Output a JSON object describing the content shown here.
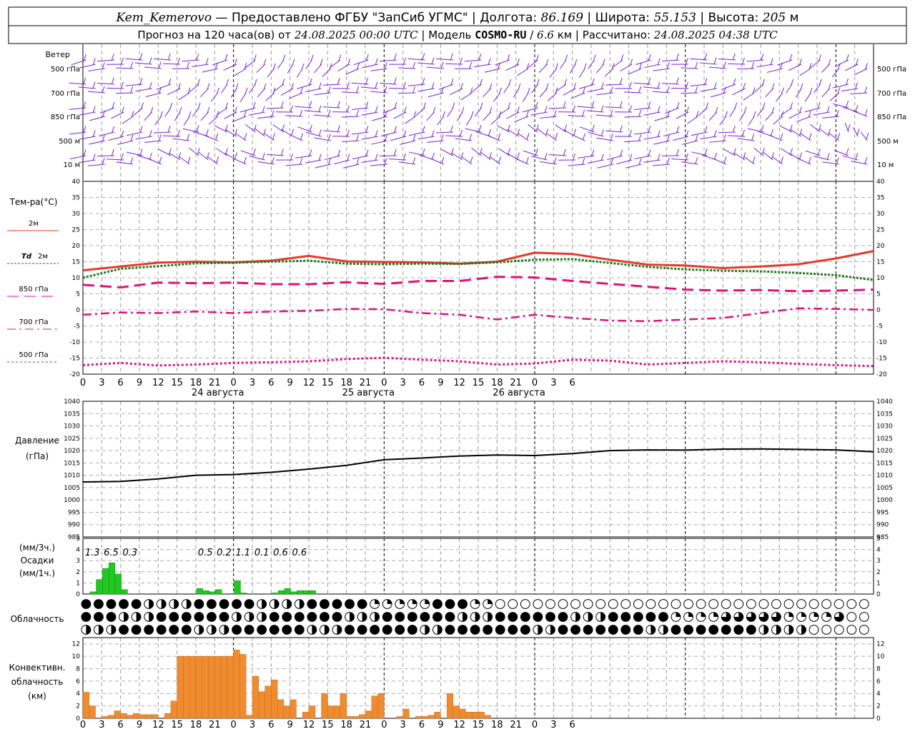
{
  "header": {
    "station": "Kem_Kemerovo",
    "provider": "Предоставлено ФГБУ \"ЗапСиб УГМС\"",
    "lon_label": "Долгота:",
    "lon_value": "86.169",
    "lat_label": "Широта:",
    "lat_value": "55.153",
    "alt_label": "Высота:",
    "alt_value": "205",
    "alt_unit": "м",
    "forecast_prefix": "Прогноз на 120 часа(ов) от",
    "forecast_time": "24.08.2025 00:00 UTC",
    "model_label": "Модель",
    "model_name": "COSMO-RU",
    "model_res": "6.6",
    "model_res_unit": "км",
    "calc_label": "Рассчитано:",
    "calc_time": "24.08.2025 04:38 UTC"
  },
  "wind_panel": {
    "title": "Ветер",
    "levels": [
      "500 гПа",
      "700 гПа",
      "850 гПа",
      "500 м",
      "10 м"
    ],
    "color": "#7a1fd6"
  },
  "x_axis": {
    "tick_labels": [
      "0",
      "3",
      "6",
      "9",
      "12",
      "15",
      "18",
      "21",
      "0",
      "3",
      "6",
      "9",
      "12",
      "15",
      "18",
      "21",
      "0",
      "3",
      "6",
      "9",
      "12",
      "15",
      "18",
      "21",
      "0",
      "3",
      "6"
    ],
    "day_labels": [
      "24 августа",
      "25 августа",
      "26 августа"
    ]
  },
  "temp_panel": {
    "title": "Тем-ра(°C)",
    "legend": [
      {
        "label": "2м",
        "color": "#e8382e"
      },
      {
        "label": "Td",
        "label2": "2м",
        "color": "#1a7a1a"
      },
      {
        "label": "850 гПа",
        "color": "#e0127a"
      },
      {
        "label": "700 гПа",
        "color": "#e0127a"
      },
      {
        "label": "500 гПа",
        "color": "#e0127a"
      }
    ]
  },
  "pressure_panel": {
    "title1": "Давление",
    "title2": "(гПа)"
  },
  "precip_panel": {
    "title1": "(мм/3ч.)",
    "title2": "Осадки",
    "title3": "(мм/1ч.)",
    "color": "#22c822",
    "labels": [
      {
        "h": 3,
        "text": "1.3"
      },
      {
        "h": 6,
        "text": "6.5"
      },
      {
        "h": 9,
        "text": "0.3"
      },
      {
        "h": 21,
        "text": "0.5"
      },
      {
        "h": 24,
        "text": "0.2"
      },
      {
        "h": 27,
        "text": "1.1"
      },
      {
        "h": 30,
        "text": "0.1"
      },
      {
        "h": 33,
        "text": "0.6"
      },
      {
        "h": 36,
        "text": "0.6"
      }
    ]
  },
  "cloud_panel": {
    "title": "Облачность"
  },
  "conv_panel": {
    "title1": "Конвективн.",
    "title2": "облачность",
    "title3": "(км)",
    "color": "#f08c30"
  },
  "chart_data": [
    {
      "type": "line",
      "name": "temperature",
      "x_unit": "hours since 24.08.2025 00:00 UTC",
      "ylim": [
        -20,
        40
      ],
      "y_ticks": [
        -20,
        -15,
        -10,
        -5,
        0,
        5,
        10,
        15,
        20,
        25,
        30,
        35,
        40
      ],
      "grid": true,
      "series": [
        {
          "name": "2м",
          "color": "#e8382e",
          "x": [
            0,
            6,
            12,
            18,
            24,
            30,
            36,
            42,
            48,
            54,
            60,
            66,
            72,
            78,
            84,
            90,
            96,
            102,
            108,
            114,
            120,
            126
          ],
          "values": [
            12.3,
            13.5,
            14.7,
            15.0,
            14.8,
            15.3,
            16.8,
            15.1,
            14.9,
            14.8,
            14.4,
            15.0,
            17.8,
            17.4,
            15.6,
            14.1,
            13.8,
            13.0,
            13.5,
            14.2,
            16.0,
            18.3
          ]
        },
        {
          "name": "Td 2м",
          "color": "#1a7a1a",
          "x": [
            0,
            6,
            12,
            18,
            24,
            30,
            36,
            42,
            48,
            54,
            60,
            66,
            72,
            78,
            84,
            90,
            96,
            102,
            108,
            114,
            120,
            126
          ],
          "values": [
            10.0,
            12.8,
            13.6,
            14.5,
            14.7,
            15.0,
            15.3,
            14.4,
            14.2,
            14.4,
            14.3,
            14.8,
            15.6,
            15.8,
            14.6,
            13.4,
            12.6,
            12.2,
            12.0,
            11.5,
            10.8,
            9.3
          ]
        },
        {
          "name": "850 гПа",
          "color": "#e0127a",
          "x": [
            0,
            6,
            12,
            18,
            24,
            30,
            36,
            42,
            48,
            54,
            60,
            66,
            72,
            78,
            84,
            90,
            96,
            102,
            108,
            114,
            120,
            126
          ],
          "values": [
            7.8,
            7.0,
            8.5,
            8.3,
            8.5,
            8.0,
            8.0,
            8.6,
            8.1,
            9.0,
            9.0,
            10.3,
            10.1,
            9.0,
            8.1,
            7.2,
            6.3,
            6.0,
            6.2,
            5.8,
            6.0,
            6.3
          ]
        },
        {
          "name": "700 гПа",
          "color": "#e0127a",
          "x": [
            0,
            6,
            12,
            18,
            24,
            30,
            36,
            42,
            48,
            54,
            60,
            66,
            72,
            78,
            84,
            90,
            96,
            102,
            108,
            114,
            120,
            126
          ],
          "values": [
            -1.5,
            -0.8,
            -1.0,
            -0.5,
            -1.0,
            -0.5,
            -0.3,
            0.3,
            0.2,
            -1.0,
            -1.5,
            -3.0,
            -1.5,
            -2.5,
            -3.3,
            -3.5,
            -3.0,
            -2.5,
            -1.0,
            0.5,
            0.3,
            0.0
          ]
        },
        {
          "name": "500 гПа",
          "color": "#e0127a",
          "x": [
            0,
            6,
            12,
            18,
            24,
            30,
            36,
            42,
            48,
            54,
            60,
            66,
            72,
            78,
            84,
            90,
            96,
            102,
            108,
            114,
            120,
            126
          ],
          "values": [
            -17.2,
            -16.5,
            -17.3,
            -17.0,
            -16.5,
            -16.3,
            -16.0,
            -15.3,
            -14.9,
            -15.5,
            -16.0,
            -17.0,
            -16.7,
            -15.5,
            -15.8,
            -17.0,
            -16.5,
            -16.0,
            -16.3,
            -16.8,
            -17.2,
            -17.5
          ]
        }
      ]
    },
    {
      "type": "line",
      "name": "pressure",
      "x_unit": "hours since 24.08.2025 00:00 UTC",
      "ylim": [
        985,
        1040
      ],
      "y_ticks": [
        985,
        990,
        995,
        1000,
        1005,
        1010,
        1015,
        1020,
        1025,
        1030,
        1035,
        1040
      ],
      "grid": true,
      "series": [
        {
          "name": "pressure",
          "color": "#000000",
          "x": [
            0,
            6,
            12,
            18,
            24,
            30,
            36,
            42,
            48,
            54,
            60,
            66,
            72,
            78,
            84,
            90,
            96,
            102,
            108,
            114,
            120,
            126
          ],
          "values": [
            1007.3,
            1007.5,
            1008.5,
            1010.0,
            1010.3,
            1011.2,
            1012.5,
            1014.0,
            1016.3,
            1017.0,
            1017.8,
            1018.2,
            1018.0,
            1018.8,
            1020.0,
            1020.3,
            1020.2,
            1020.6,
            1020.7,
            1020.5,
            1020.3,
            1019.5
          ]
        }
      ]
    },
    {
      "type": "bar",
      "name": "precipitation",
      "x_unit": "hours since 24.08.2025 00:00 UTC",
      "ylim": [
        0,
        5
      ],
      "y_ticks": [
        0,
        1,
        2,
        3,
        4,
        5
      ],
      "x": [
        0,
        1,
        2,
        3,
        4,
        5,
        6,
        7,
        8,
        9,
        10,
        11,
        12,
        13,
        14,
        15,
        16,
        17,
        18,
        19,
        20,
        21,
        22,
        23,
        24,
        25,
        26,
        27,
        28,
        29,
        30,
        31,
        32,
        33,
        34,
        35,
        36,
        37,
        38,
        39
      ],
      "values": [
        0.0,
        0.2,
        1.3,
        2.3,
        2.8,
        1.8,
        0.4,
        0.0,
        0.0,
        0.0,
        0.0,
        0.0,
        0.0,
        0.0,
        0.0,
        0.0,
        0.0,
        0.0,
        0.5,
        0.3,
        0.2,
        0.4,
        0.0,
        0.0,
        1.2,
        0.1,
        0.0,
        0.0,
        0.0,
        0.0,
        0.1,
        0.3,
        0.5,
        0.2,
        0.3,
        0.3,
        0.3,
        0.0,
        0.0,
        0.0
      ]
    },
    {
      "type": "bar",
      "name": "convective_cloud",
      "x_unit": "hours since 24.08.2025 00:00 UTC",
      "ylim": [
        0,
        13
      ],
      "y_ticks": [
        0,
        2,
        4,
        6,
        8,
        10,
        12
      ],
      "x": [
        0,
        1,
        2,
        3,
        4,
        5,
        6,
        7,
        8,
        9,
        10,
        11,
        12,
        13,
        14,
        15,
        16,
        17,
        18,
        19,
        20,
        21,
        22,
        23,
        24,
        25,
        26,
        27,
        28,
        29,
        30,
        31,
        32,
        33,
        34,
        35,
        36,
        37,
        38,
        39,
        40,
        41,
        42,
        43,
        44,
        45,
        46,
        47,
        48,
        49,
        50,
        51,
        52,
        53,
        54,
        55,
        56,
        57,
        58,
        59,
        60,
        61,
        62,
        63,
        64,
        65,
        66,
        67,
        68,
        69,
        70,
        71,
        72,
        73,
        74,
        75,
        76,
        77,
        78,
        79,
        80,
        81,
        82,
        83,
        84,
        85,
        86,
        87,
        88,
        89,
        90,
        91,
        92,
        93,
        94,
        95,
        96,
        97,
        98,
        99,
        100,
        101,
        102,
        103,
        104,
        105,
        106,
        107,
        108,
        109,
        110,
        111,
        112,
        113,
        114,
        115,
        116,
        117,
        118,
        119
      ],
      "values": [
        4.2,
        2.0,
        0.0,
        0.3,
        0.5,
        1.2,
        0.8,
        0.5,
        0.8,
        0.6,
        0.6,
        0.6,
        0.0,
        0.8,
        2.8,
        10.0,
        10.0,
        10.0,
        10.0,
        10.0,
        10.0,
        10.0,
        10.0,
        10.0,
        11.0,
        10.3,
        0.5,
        6.8,
        4.3,
        5.2,
        6.2,
        3.0,
        2.0,
        3.0,
        0.0,
        1.0,
        2.0,
        0.0,
        4.0,
        2.0,
        2.0,
        4.0,
        0.3,
        0.3,
        0.6,
        1.2,
        3.6,
        4.0,
        0.0,
        0.0,
        0.3,
        1.5,
        0.0,
        0.3,
        0.3,
        0.5,
        1.0,
        0.0,
        4.0,
        2.0,
        1.5,
        1.0,
        1.0,
        1.0,
        0.5,
        0.0,
        0.0,
        0.0,
        0.0,
        0.0,
        0.0,
        0.0,
        0.0,
        0.0,
        0.0,
        0.0,
        0.0,
        0.0,
        0.0,
        0.0,
        0.0,
        0.0,
        0.0,
        0.0,
        0.0,
        0.0,
        0.0,
        0.0,
        0.0,
        0.0,
        0.0,
        0.0,
        0.0,
        0.0,
        0.0,
        0.0,
        0.0,
        0.0,
        0.0,
        0.0,
        0.0,
        0.0,
        0.0,
        0.0,
        0.0,
        0.0,
        0.0,
        0.0,
        0.0,
        0.0,
        0.0,
        0.0,
        0.0,
        0.0,
        0.0,
        0.0,
        0.0,
        0.0,
        0.0,
        0.0
      ]
    }
  ]
}
